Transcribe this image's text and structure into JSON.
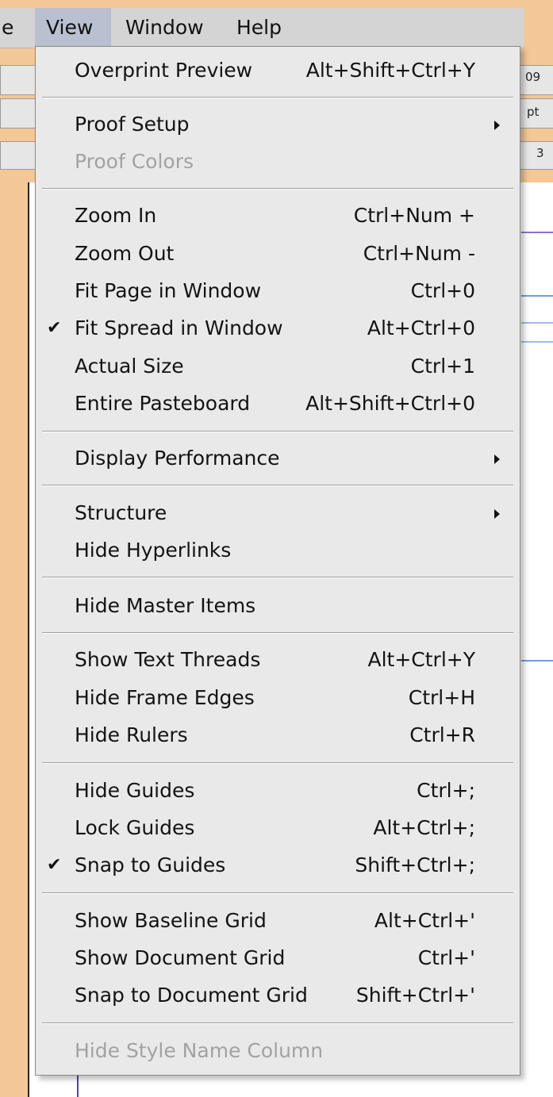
{
  "menubar": {
    "partial_label": "e",
    "items": [
      {
        "label": "View",
        "active": true
      },
      {
        "label": "Window"
      },
      {
        "label": "Help"
      }
    ]
  },
  "background": {
    "right_text_1": "09",
    "right_text_2": "pt",
    "right_text_3": "3"
  },
  "menu": {
    "title": "View",
    "items": [
      {
        "label": "Overprint Preview",
        "shortcut": "Alt+Shift+Ctrl+Y"
      },
      {
        "label": "Proof Setup",
        "submenu": true
      },
      {
        "label": "Proof Colors",
        "disabled": true
      },
      {
        "label": "Zoom In",
        "shortcut": "Ctrl+Num +"
      },
      {
        "label": "Zoom Out",
        "shortcut": "Ctrl+Num -"
      },
      {
        "label": "Fit Page in Window",
        "shortcut": "Ctrl+0"
      },
      {
        "label": "Fit Spread in Window",
        "shortcut": "Alt+Ctrl+0",
        "checked": true
      },
      {
        "label": "Actual Size",
        "shortcut": "Ctrl+1"
      },
      {
        "label": "Entire Pasteboard",
        "shortcut": "Alt+Shift+Ctrl+0"
      },
      {
        "label": "Display Performance",
        "submenu": true
      },
      {
        "label": "Structure",
        "submenu": true
      },
      {
        "label": "Hide Hyperlinks"
      },
      {
        "label": "Hide Master Items"
      },
      {
        "label": "Show Text Threads",
        "shortcut": "Alt+Ctrl+Y"
      },
      {
        "label": "Hide Frame Edges",
        "shortcut": "Ctrl+H"
      },
      {
        "label": "Hide Rulers",
        "shortcut": "Ctrl+R"
      },
      {
        "label": "Hide Guides",
        "shortcut": "Ctrl+;"
      },
      {
        "label": "Lock Guides",
        "shortcut": "Alt+Ctrl+;"
      },
      {
        "label": "Snap to Guides",
        "shortcut": "Shift+Ctrl+;",
        "checked": true
      },
      {
        "label": "Show Baseline Grid",
        "shortcut": "Alt+Ctrl+'"
      },
      {
        "label": "Show Document Grid",
        "shortcut": "Ctrl+'"
      },
      {
        "label": "Snap to Document Grid",
        "shortcut": "Shift+Ctrl+'"
      },
      {
        "label": "Hide Style Name Column",
        "disabled": true
      }
    ],
    "check_glyph": "✔"
  },
  "colors": {
    "frame": "#f3c896",
    "menu_bg": "#e9e9e9",
    "active_menubar": "#b9c0cf",
    "disabled_text": "#a2a2a2"
  }
}
